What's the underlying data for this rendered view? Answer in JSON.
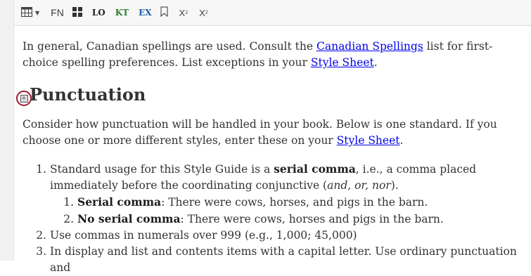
{
  "toolbar": {
    "items": [
      {
        "icon": "table-icon"
      },
      {
        "icon": "chevron-down-icon"
      },
      {
        "label": "FN"
      },
      {
        "icon": "grid-icon"
      },
      {
        "label": "LO"
      },
      {
        "label": "KT"
      },
      {
        "label": "EX"
      },
      {
        "icon": "bookmark-icon"
      },
      {
        "label": "X",
        "sup": "2"
      },
      {
        "label": "X",
        "sub": "2"
      }
    ]
  },
  "intro": {
    "text_1": "In general, Canadian spellings are used. Consult the ",
    "link_1": "Canadian Spellings",
    "text_2": " list for first-choice spelling preferences. List exceptions in your ",
    "link_2": "Style Sheet",
    "text_3": "."
  },
  "section": {
    "heading": "Punctuation",
    "collapse_icon": "collapse-icon",
    "intro_text": "Consider how punctuation will be handled in your book. Below is one standard. If you choose one or more different styles, enter these on your ",
    "intro_link": "Style Sheet",
    "intro_end": "."
  },
  "list": {
    "item1": {
      "pre": "Standard usage for this Style Guide is a ",
      "bold": "serial comma",
      "mid": ", i.e., a comma placed immediately before the coordinating conjunctive (",
      "italic": "and, or, nor",
      "end": ").",
      "sub": [
        {
          "bold": "Serial comma",
          "text": ": There were cows, horses, and pigs in the barn."
        },
        {
          "bold": "No serial comma",
          "text": ": There were cows, horses and pigs in the barn."
        }
      ]
    },
    "item2": "Use commas in numerals over 999 (e.g., 1,000; 45,000)",
    "item3": "In display and list and contents items with a capital letter. Use ordinary punctuation and"
  },
  "colors": {
    "link": "#0000ee",
    "kt": "#2f7d32",
    "ex": "#1b5ea8",
    "highlight_ring": "#9b1b30"
  }
}
